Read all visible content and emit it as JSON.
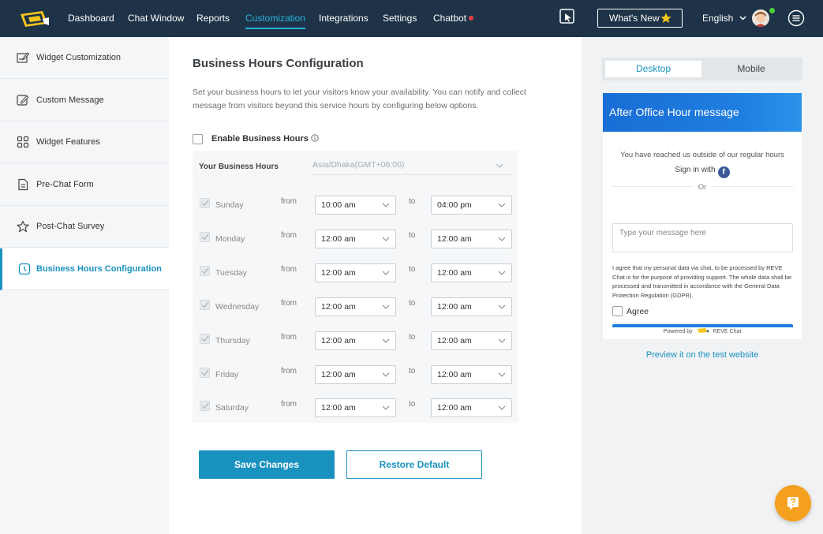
{
  "nav": {
    "items": [
      {
        "label": "Dashboard",
        "active": false
      },
      {
        "label": "Chat Window",
        "active": false
      },
      {
        "label": "Reports",
        "active": false
      },
      {
        "label": "Customization",
        "active": true
      },
      {
        "label": "Integrations",
        "active": false
      },
      {
        "label": "Settings",
        "active": false
      },
      {
        "label": "Chatbot",
        "active": false
      }
    ],
    "whats_new": "What's New",
    "language": "English",
    "colors": {
      "bar": "#1e3347",
      "active": "#27b1d9",
      "chatbot_dot": "#e8413e",
      "star": "#f5c518"
    }
  },
  "sidebar": {
    "items": [
      {
        "label": "Widget Customization",
        "icon": "widget-edit-icon"
      },
      {
        "label": "Custom Message",
        "icon": "message-edit-icon"
      },
      {
        "label": "Widget Features",
        "icon": "grid-icon"
      },
      {
        "label": "Pre-Chat Form",
        "icon": "form-icon"
      },
      {
        "label": "Post-Chat Survey",
        "icon": "star-icon"
      },
      {
        "label": "Business Hours Configuration",
        "icon": "clock-icon",
        "active": true
      }
    ]
  },
  "main": {
    "title": "Business Hours Configuration",
    "description": "Set your business hours to let your visitors know your availability. You can notify and collect message from visitors beyond this service hours by configuring below options.",
    "enable_label": "Enable Business Hours",
    "enable_checked": false,
    "hours_label": "Your Business Hours",
    "timezone": "Asia/Dhaka(GMT+06:00)",
    "from_label": "from",
    "to_label": "to",
    "days": [
      {
        "day": "Sunday",
        "from": "10:00 am",
        "to": "04:00 pm",
        "checked": true
      },
      {
        "day": "Monday",
        "from": "12:00 am",
        "to": "12:00 am",
        "checked": true
      },
      {
        "day": "Tuesday",
        "from": "12:00 am",
        "to": "12:00 am",
        "checked": true
      },
      {
        "day": "Wednesday",
        "from": "12:00 am",
        "to": "12:00 am",
        "checked": true
      },
      {
        "day": "Thursday",
        "from": "12:00 am",
        "to": "12:00 am",
        "checked": true
      },
      {
        "day": "Friday",
        "from": "12:00 am",
        "to": "12:00 am",
        "checked": true
      },
      {
        "day": "Saturday",
        "from": "12:00 am",
        "to": "12:00 am",
        "checked": true
      }
    ],
    "save_label": "Save Changes",
    "restore_label": "Restore Default",
    "accent": "#1a92c0"
  },
  "preview": {
    "tabs": {
      "desktop": "Desktop",
      "mobile": "Mobile",
      "active": "Desktop"
    },
    "header": "After Office Hour message",
    "message": "You have reached us outside of our regular hours",
    "sign_in": "Sign in with",
    "or": "Or",
    "input_placeholder": "Type your message here",
    "consent": "I agree that my personal data via chat, to be processed by REVE Chat is for the purpose of providing support. The whole data shall be processed and transmitted in accordance with the General Data Protection Regulation (GDPR).",
    "agree": "Agree",
    "powered_by": "Powered by",
    "brand": "REVE Chat",
    "preview_link": "Preview it on the test website",
    "header_color": "#1e7fe0"
  },
  "help_bubble": {
    "icon": "help-chat-icon",
    "color": "#f5a01e"
  }
}
